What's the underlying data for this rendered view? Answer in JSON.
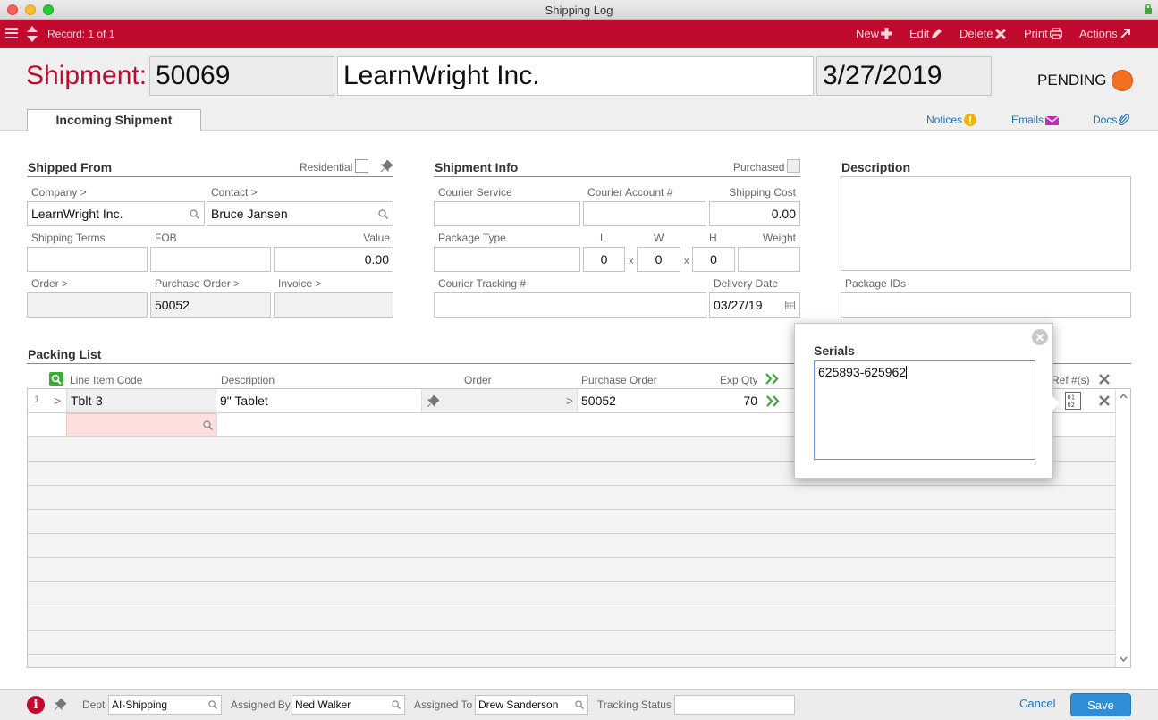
{
  "window": {
    "title": "Shipping Log"
  },
  "toolbar": {
    "record_label": "Record: 1 of 1",
    "new_label": "New",
    "edit_label": "Edit",
    "delete_label": "Delete",
    "print_label": "Print",
    "actions_label": "Actions"
  },
  "header": {
    "shipment_label": "Shipment:",
    "shipment_number": "50069",
    "company_name": "LearnWright Inc.",
    "date": "3/27/2019",
    "status": "PENDING",
    "status_color": "#f36f21",
    "tab_label": "Incoming Shipment",
    "notices_label": "Notices",
    "emails_label": "Emails",
    "docs_label": "Docs"
  },
  "shipped_from": {
    "title": "Shipped From",
    "residential_label": "Residential",
    "company_label": "Company >",
    "company_value": "LearnWright Inc.",
    "contact_label": "Contact >",
    "contact_value": "Bruce Jansen",
    "shipping_terms_label": "Shipping Terms",
    "shipping_terms_value": "",
    "fob_label": "FOB",
    "fob_value": "",
    "value_label": "Value",
    "value_value": "0.00",
    "order_label": "Order >",
    "order_value": "",
    "purchase_order_label": "Purchase Order >",
    "purchase_order_value": "50052",
    "invoice_label": "Invoice >",
    "invoice_value": ""
  },
  "shipment_info": {
    "title": "Shipment Info",
    "purchased_label": "Purchased",
    "courier_service_label": "Courier Service",
    "courier_account_label": "Courier Account #",
    "shipping_cost_label": "Shipping Cost",
    "shipping_cost_value": "0.00",
    "package_type_label": "Package Type",
    "l_label": "L",
    "w_label": "W",
    "h_label": "H",
    "weight_label": "Weight",
    "l_value": "0",
    "w_value": "0",
    "h_value": "0",
    "x_sep": "x",
    "courier_tracking_label": "Courier Tracking #",
    "delivery_date_label": "Delivery Date",
    "delivery_date_value": "03/27/19"
  },
  "description": {
    "title": "Description",
    "package_ids_label": "Package IDs"
  },
  "packing_list": {
    "title": "Packing List",
    "columns": {
      "line_item_code": "Line Item Code",
      "description": "Description",
      "order": "Order",
      "purchase_order": "Purchase Order",
      "exp_qty": "Exp Qty",
      "ref": "Ref #(s)"
    },
    "rows": [
      {
        "num": "1",
        "expand": ">",
        "code": "Tblt-3",
        "description": "9\" Tablet",
        "order_arrow": ">",
        "purchase_order": "50052",
        "exp_qty": "70"
      }
    ]
  },
  "serials_popover": {
    "title": "Serials",
    "value": "625893-625962"
  },
  "footer": {
    "dept_label": "Dept",
    "dept_value": "AI-Shipping",
    "assigned_by_label": "Assigned By",
    "assigned_by_value": "Ned Walker",
    "assigned_to_label": "Assigned To",
    "assigned_to_value": "Drew Sanderson",
    "tracking_status_label": "Tracking Status",
    "tracking_status_value": "",
    "cancel_label": "Cancel",
    "save_label": "Save",
    "info_glyph": "i"
  },
  "colors": {
    "accent_red": "#c00a2e",
    "link_blue": "#1b74c4",
    "save_blue": "#2f8ed9",
    "green_icon": "#3aa935"
  }
}
